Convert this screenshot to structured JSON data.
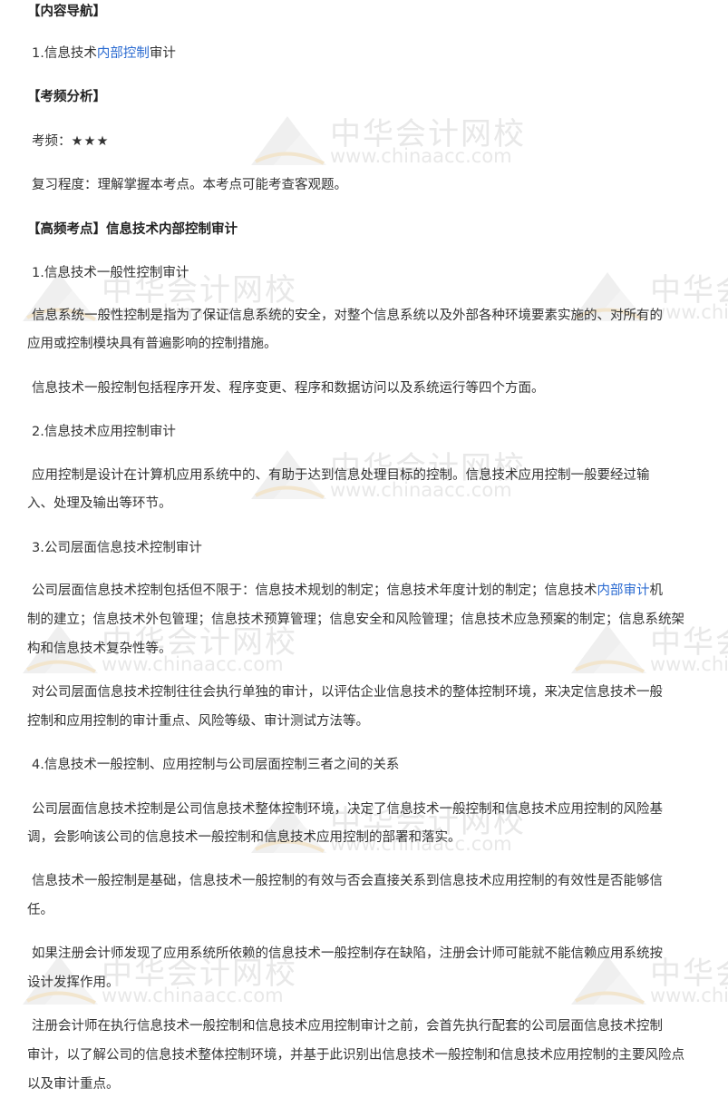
{
  "nav_heading": "【内容导航】",
  "nav_item": {
    "prefix": "1.信息技术",
    "link": "内部控制",
    "suffix": "审计"
  },
  "freq_heading": "【考频分析】",
  "freq": {
    "label": "考频：",
    "stars": "★★★"
  },
  "review": "复习程度：理解掌握本考点。本考点可能考查客观题。",
  "topic_heading": "【高频考点】信息技术内部控制审计",
  "sections": {
    "s1_title": "1.信息技术一般性控制审计",
    "s1_p1_line1": "信息系统一般性控制是指为了保证信息系统的安全，对整个信息系统以及外部各种环境要素实施的、对所有的",
    "s1_p1_line2": "应用或控制模块具有普遍影响的控制措施。",
    "s1_p2": "信息技术一般控制包括程序开发、程序变更、程序和数据访问以及系统运行等四个方面。",
    "s2_title": "2.信息技术应用控制审计",
    "s2_p1_line1": "应用控制是设计在计算机应用系统中的、有助于达到信息处理目标的控制。信息技术应用控制一般要经过输",
    "s2_p1_line2": "入、处理及输出等环节。",
    "s3_title": "3.公司层面信息技术控制审计",
    "s3_p1_line1_prefix": "公司层面信息技术控制包括但不限于：信息技术规划的制定；信息技术年度计划的制定；信息技术",
    "s3_p1_line1_link": "内部审计",
    "s3_p1_line1_suffix": "机",
    "s3_p1_line2": "制的建立；信息技术外包管理；信息技术预算管理；信息安全和风险管理；信息技术应急预案的制定；信息系统架",
    "s3_p1_line3": "构和信息技术复杂性等。",
    "s3_p2_line1": "对公司层面信息技术控制往往会执行单独的审计，以评估企业信息技术的整体控制环境，来决定信息技术一般",
    "s3_p2_line2": "控制和应用控制的审计重点、风险等级、审计测试方法等。",
    "s4_title": "4.信息技术一般控制、应用控制与公司层面控制三者之间的关系",
    "s4_p1_line1": "公司层面信息技术控制是公司信息技术整体控制环境，决定了信息技术一般控制和信息技术应用控制的风险基",
    "s4_p1_line2": "调，会影响该公司的信息技术一般控制和信息技术应用控制的部署和落实。",
    "s4_p2_line1": "信息技术一般控制是基础，信息技术一般控制的有效与否会直接关系到信息技术应用控制的有效性是否能够信",
    "s4_p2_line2": "任。",
    "s4_p3_line1": "如果注册会计师发现了应用系统所依赖的信息技术一般控制存在缺陷，注册会计师可能就不能信赖应用系统按",
    "s4_p3_line2": "设计发挥作用。",
    "s4_p4_line1": "注册会计师在执行信息技术一般控制和信息技术应用控制审计之前，会首先执行配套的公司层面信息技术控制",
    "s4_p4_line2": "审计，以了解公司的信息技术整体控制环境，并基于此识别出信息技术一般控制和信息技术应用控制的主要风险点",
    "s4_p4_line3": "以及审计重点。"
  },
  "watermark": {
    "name": "中华会计网校",
    "url": "www.chinaacc.com"
  },
  "colors": {
    "link": "#2b6bd1",
    "text": "#333333",
    "watermark": "#e6e6e6"
  }
}
